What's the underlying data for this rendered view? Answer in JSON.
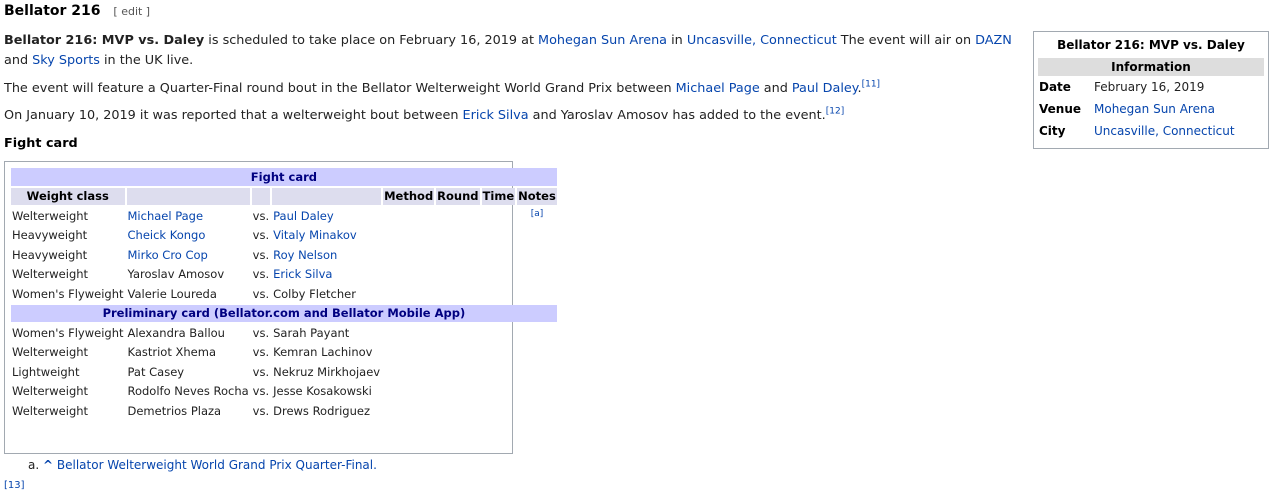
{
  "heading": {
    "title": "Bellator 216",
    "edit": "[ edit ]"
  },
  "intro": {
    "event_bold": "Bellator 216: MVP vs. Daley",
    "t1": " is scheduled to take place on February 16, 2019 at ",
    "venue": "Mohegan Sun Arena",
    "t2": " in ",
    "city": "Uncasville, Connecticut",
    "t3": " The event will air on ",
    "dazn": "DAZN",
    "t4": " and ",
    "sky": "Sky Sports",
    "t5": " in the UK live."
  },
  "para2": {
    "t1": "The event will feature a Quarter-Final round bout in the Bellator Welterweight World Grand Prix between ",
    "page": "Michael Page",
    "t2": " and ",
    "daley": "Paul Daley",
    "t3": ".",
    "ref": "[11]"
  },
  "para3": {
    "t1": "On January 10, 2019 it was reported that a welterweight bout between ",
    "silva": "Erick Silva",
    "t2": " and Yaroslav Amosov has added to the event.",
    "ref": "[12]"
  },
  "infobox": {
    "title": "Bellator 216: MVP vs. Daley",
    "subheader": "Information",
    "date_label": "Date",
    "date_value": "February 16, 2019",
    "venue_label": "Venue",
    "venue_value": "Mohegan Sun Arena",
    "city_label": "City",
    "city_value": "Uncasville, Connecticut"
  },
  "fight_card": {
    "label": "Fight card",
    "main_title": "Fight card",
    "prelim_title": "Preliminary card (Bellator.com and Bellator Mobile App)",
    "headers": {
      "weight": "Weight class",
      "method": "Method",
      "round": "Round",
      "time": "Time",
      "notes": "Notes"
    },
    "main": [
      {
        "weight": "Welterweight",
        "f1": "Michael Page",
        "vs": "vs.",
        "f2": "Paul Daley",
        "note": "[a]"
      },
      {
        "weight": "Heavyweight",
        "f1": "Cheick Kongo",
        "vs": "vs.",
        "f2": "Vitaly Minakov",
        "note": ""
      },
      {
        "weight": "Heavyweight",
        "f1": "Mirko Cro Cop",
        "vs": "vs.",
        "f2": "Roy Nelson",
        "note": ""
      },
      {
        "weight": "Welterweight",
        "f1": "Yaroslav Amosov",
        "vs": "vs.",
        "f2": "Erick Silva",
        "note": ""
      },
      {
        "weight": "Women's Flyweight",
        "f1": "Valerie Loureda",
        "vs": "vs.",
        "f2": "Colby Fletcher",
        "note": ""
      }
    ],
    "prelim": [
      {
        "weight": "Women's Flyweight",
        "f1": "Alexandra Ballou",
        "vs": "vs.",
        "f2": "Sarah Payant",
        "note": ""
      },
      {
        "weight": "Welterweight",
        "f1": "Kastriot Xhema",
        "vs": "vs.",
        "f2": "Kemran Lachinov",
        "note": ""
      },
      {
        "weight": "Lightweight",
        "f1": "Pat Casey",
        "vs": "vs.",
        "f2": "Nekruz Mirkhojaev",
        "note": ""
      },
      {
        "weight": "Welterweight",
        "f1": "Rodolfo Neves Rocha",
        "vs": "vs.",
        "f2": "Jesse Kosakowski",
        "note": ""
      },
      {
        "weight": "Welterweight",
        "f1": "Demetrios Plaza",
        "vs": "vs.",
        "f2": "Drews Rodriguez",
        "note": ""
      }
    ]
  },
  "footnote": {
    "marker": "a.",
    "caret": "^",
    "text": "Bellator Welterweight World Grand Prix Quarter-Final."
  },
  "ref13": "[13]",
  "colors": {
    "link": "#0645ad",
    "section_bg": "#ccccff",
    "section_text": "#000080",
    "header_bg": "#ddddee"
  }
}
